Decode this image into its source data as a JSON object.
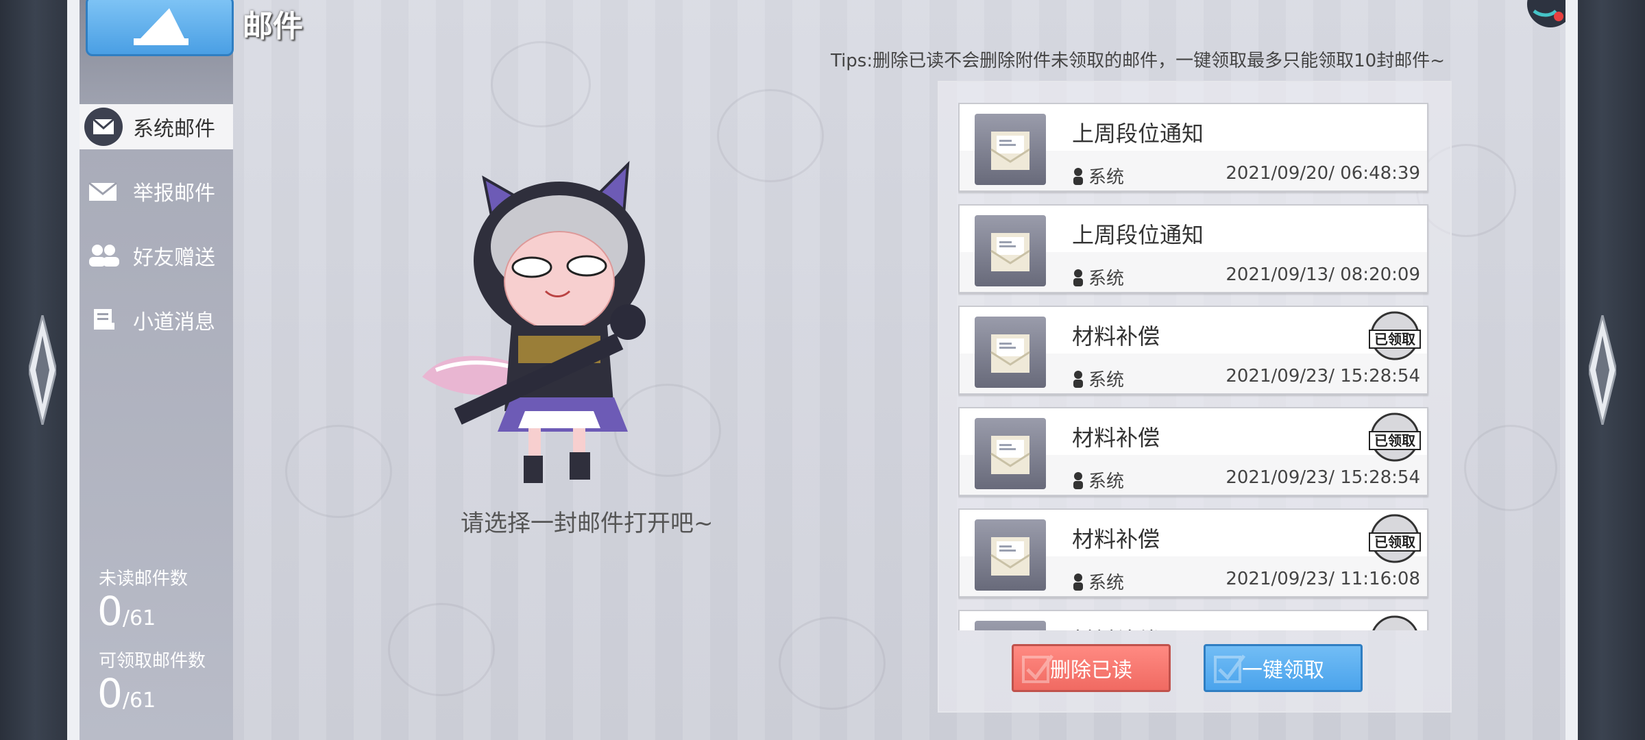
{
  "header": {
    "back_label": "",
    "title": "邮件"
  },
  "sidebar": {
    "items": [
      {
        "label": "系统邮件",
        "icon": "envelope-icon",
        "active": true
      },
      {
        "label": "举报邮件",
        "icon": "report-mail-icon",
        "active": false
      },
      {
        "label": "好友赠送",
        "icon": "friends-icon",
        "active": false
      },
      {
        "label": "小道消息",
        "icon": "news-icon",
        "active": false
      }
    ],
    "stats": {
      "unread_label": "未读邮件数",
      "unread_count": "0",
      "unread_total": "61",
      "claimable_label": "可领取邮件数",
      "claimable_count": "0",
      "claimable_total": "61"
    }
  },
  "tips": "Tips:删除已读不会删除附件未领取的邮件，一键领取最多只能领取10封邮件~",
  "empty_hint": "请选择一封邮件打开吧~",
  "mails": [
    {
      "title": "上周段位通知",
      "sender": "系统",
      "date": "2021/09/20/ 06:48:39",
      "claimed": false
    },
    {
      "title": "上周段位通知",
      "sender": "系统",
      "date": "2021/09/13/ 08:20:09",
      "claimed": false
    },
    {
      "title": "材料补偿",
      "sender": "系统",
      "date": "2021/09/23/ 15:28:54",
      "claimed": true
    },
    {
      "title": "材料补偿",
      "sender": "系统",
      "date": "2021/09/23/ 15:28:54",
      "claimed": true
    },
    {
      "title": "材料补偿",
      "sender": "系统",
      "date": "2021/09/23/ 11:16:08",
      "claimed": true
    },
    {
      "title": "材料补偿",
      "sender": "",
      "date": "",
      "claimed": true
    }
  ],
  "claimed_badge_text": "已领取",
  "buttons": {
    "delete_read": "删除已读",
    "claim_all": "一键领取"
  },
  "colors": {
    "delete": "#f06a62",
    "claim": "#4aa3ec",
    "back": "#4a9fe4"
  }
}
